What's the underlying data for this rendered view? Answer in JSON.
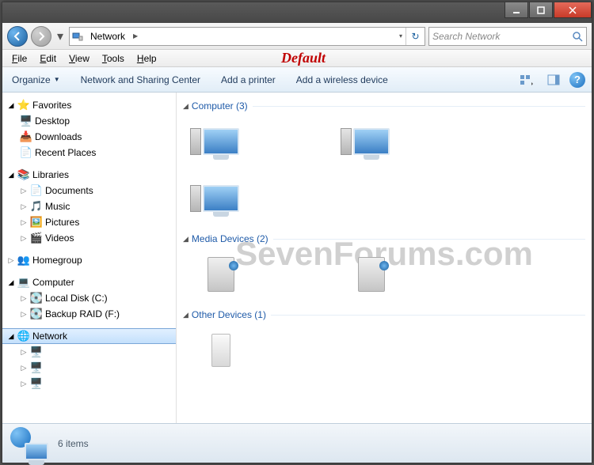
{
  "titlebar": {
    "min": "—",
    "max": "▢",
    "close": "✕"
  },
  "nav": {
    "crumb_root": "Network",
    "refresh_glyph": "↻",
    "dropdown_glyph": "▾"
  },
  "search": {
    "placeholder": "Search Network"
  },
  "menubar": {
    "file": "File",
    "edit": "Edit",
    "view": "View",
    "tools": "Tools",
    "help": "Help",
    "overlay": "Default"
  },
  "cmdbar": {
    "organize": "Organize",
    "nsc": "Network and Sharing Center",
    "add_printer": "Add a printer",
    "add_wireless": "Add a wireless device",
    "help": "?"
  },
  "sidebar": {
    "favorites": "Favorites",
    "desktop": "Desktop",
    "downloads": "Downloads",
    "recent": "Recent Places",
    "libraries": "Libraries",
    "documents": "Documents",
    "music": "Music",
    "pictures": "Pictures",
    "videos": "Videos",
    "homegroup": "Homegroup",
    "computer": "Computer",
    "localdisk": "Local Disk (C:)",
    "backup": "Backup RAID (F:)",
    "network": "Network"
  },
  "content": {
    "group_computer": "Computer (3)",
    "group_media": "Media Devices (2)",
    "group_other": "Other Devices (1)"
  },
  "statusbar": {
    "count": "6 items"
  },
  "watermark": "SevenForums.com"
}
